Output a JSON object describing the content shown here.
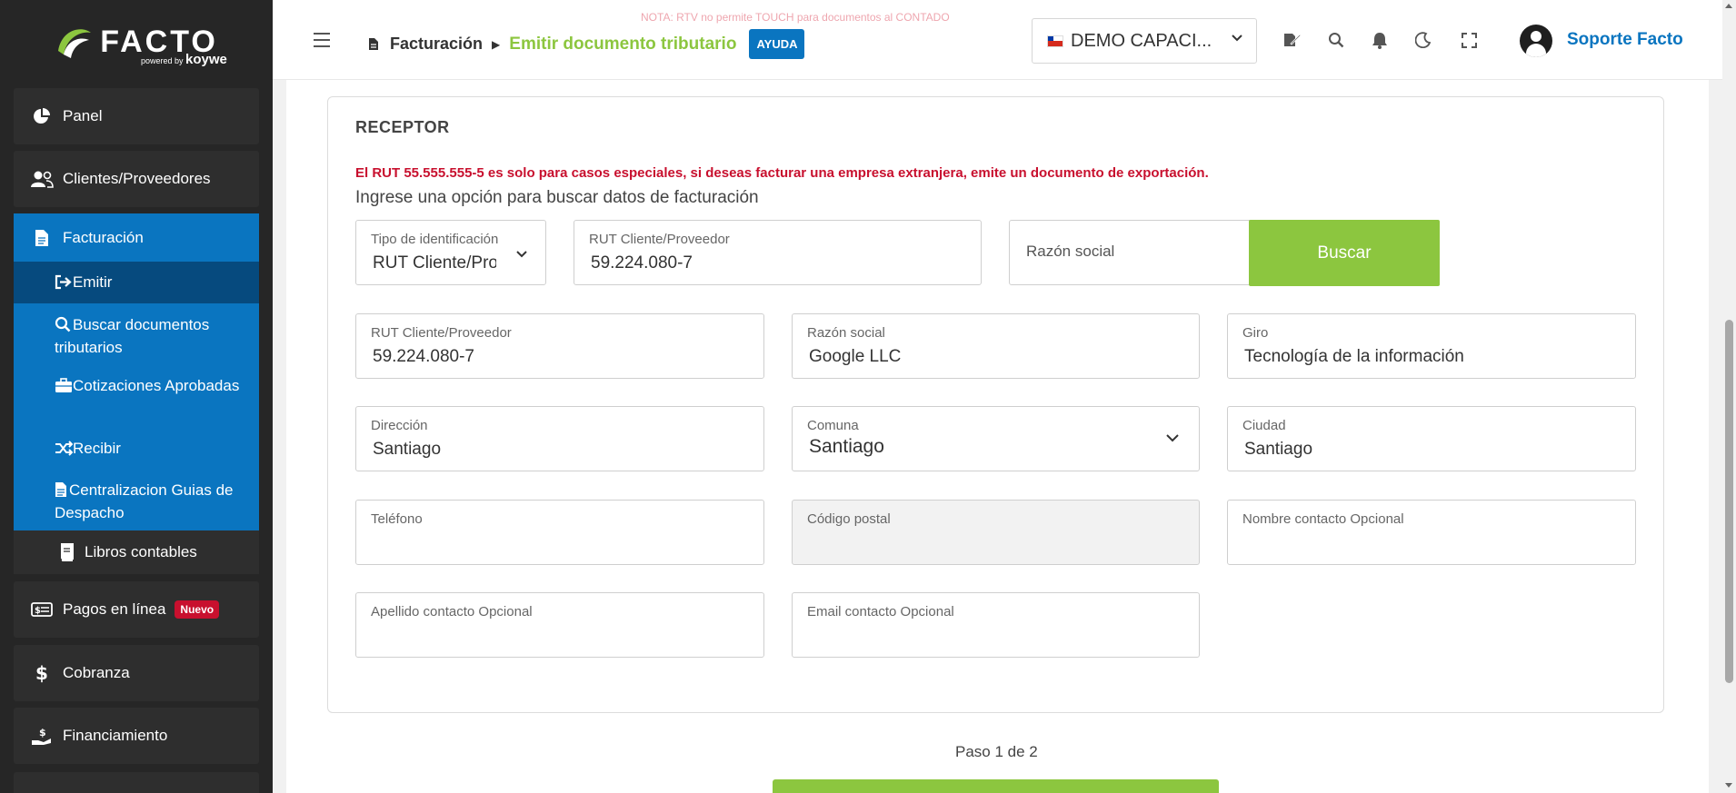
{
  "brand": {
    "name": "FACTO",
    "powered_by": "powered by",
    "powered_brand": "koywe",
    "accent_green": "#8cc63f",
    "accent_blue": "#0a75c0"
  },
  "sidebar": {
    "panel": "Panel",
    "clientes": "Clientes/Proveedores",
    "facturacion": "Facturación",
    "sub": {
      "emitir": "Emitir",
      "buscar": "Buscar documentos tributarios",
      "cotizaciones": "Cotizaciones Aprobadas",
      "recibir": "Recibir",
      "centralizacion": "Centralizacion Guias de Despacho"
    },
    "libros": "Libros contables",
    "pagos": "Pagos en línea",
    "pagos_badge": "Nuevo",
    "cobranza": "Cobranza",
    "financiamiento": "Financiamiento"
  },
  "header": {
    "notice": "NOTA: RTV no permite TOUCH para documentos al CONTADO",
    "breadcrumb_section": "Facturación",
    "breadcrumb_page": "Emitir documento tributario",
    "help": "AYUDA",
    "company": "DEMO CAPACI...",
    "user": "Soporte Facto"
  },
  "receptor": {
    "title": "RECEPTOR",
    "warning": "El RUT 55.555.555-5 es solo para casos especiales, si deseas facturar una empresa extranjera, emite un documento de exportación.",
    "hint": "Ingrese una opción para buscar datos de facturación",
    "search": {
      "tipo_label": "Tipo de identificación",
      "tipo_value": "RUT Cliente/Proveedor",
      "rut_label": "RUT Cliente/Proveedor",
      "rut_value": "59.224.080-7",
      "razon_placeholder": "Razón social",
      "button": "Buscar"
    },
    "fields": {
      "rut_label": "RUT Cliente/Proveedor",
      "rut_value": "59.224.080-7",
      "razon_label": "Razón social",
      "razon_value": "Google LLC",
      "giro_label": "Giro",
      "giro_value": "Tecnología de la información",
      "direccion_label": "Dirección",
      "direccion_value": "Santiago",
      "comuna_label": "Comuna",
      "comuna_value": "Santiago",
      "ciudad_label": "Ciudad",
      "ciudad_value": "Santiago",
      "telefono_label": "Teléfono",
      "postal_label": "Código postal",
      "nombre_label": "Nombre contacto Opcional",
      "apellido_label": "Apellido contacto Opcional",
      "email_label": "Email contacto Opcional"
    }
  },
  "footer": {
    "step": "Paso 1 de 2"
  }
}
